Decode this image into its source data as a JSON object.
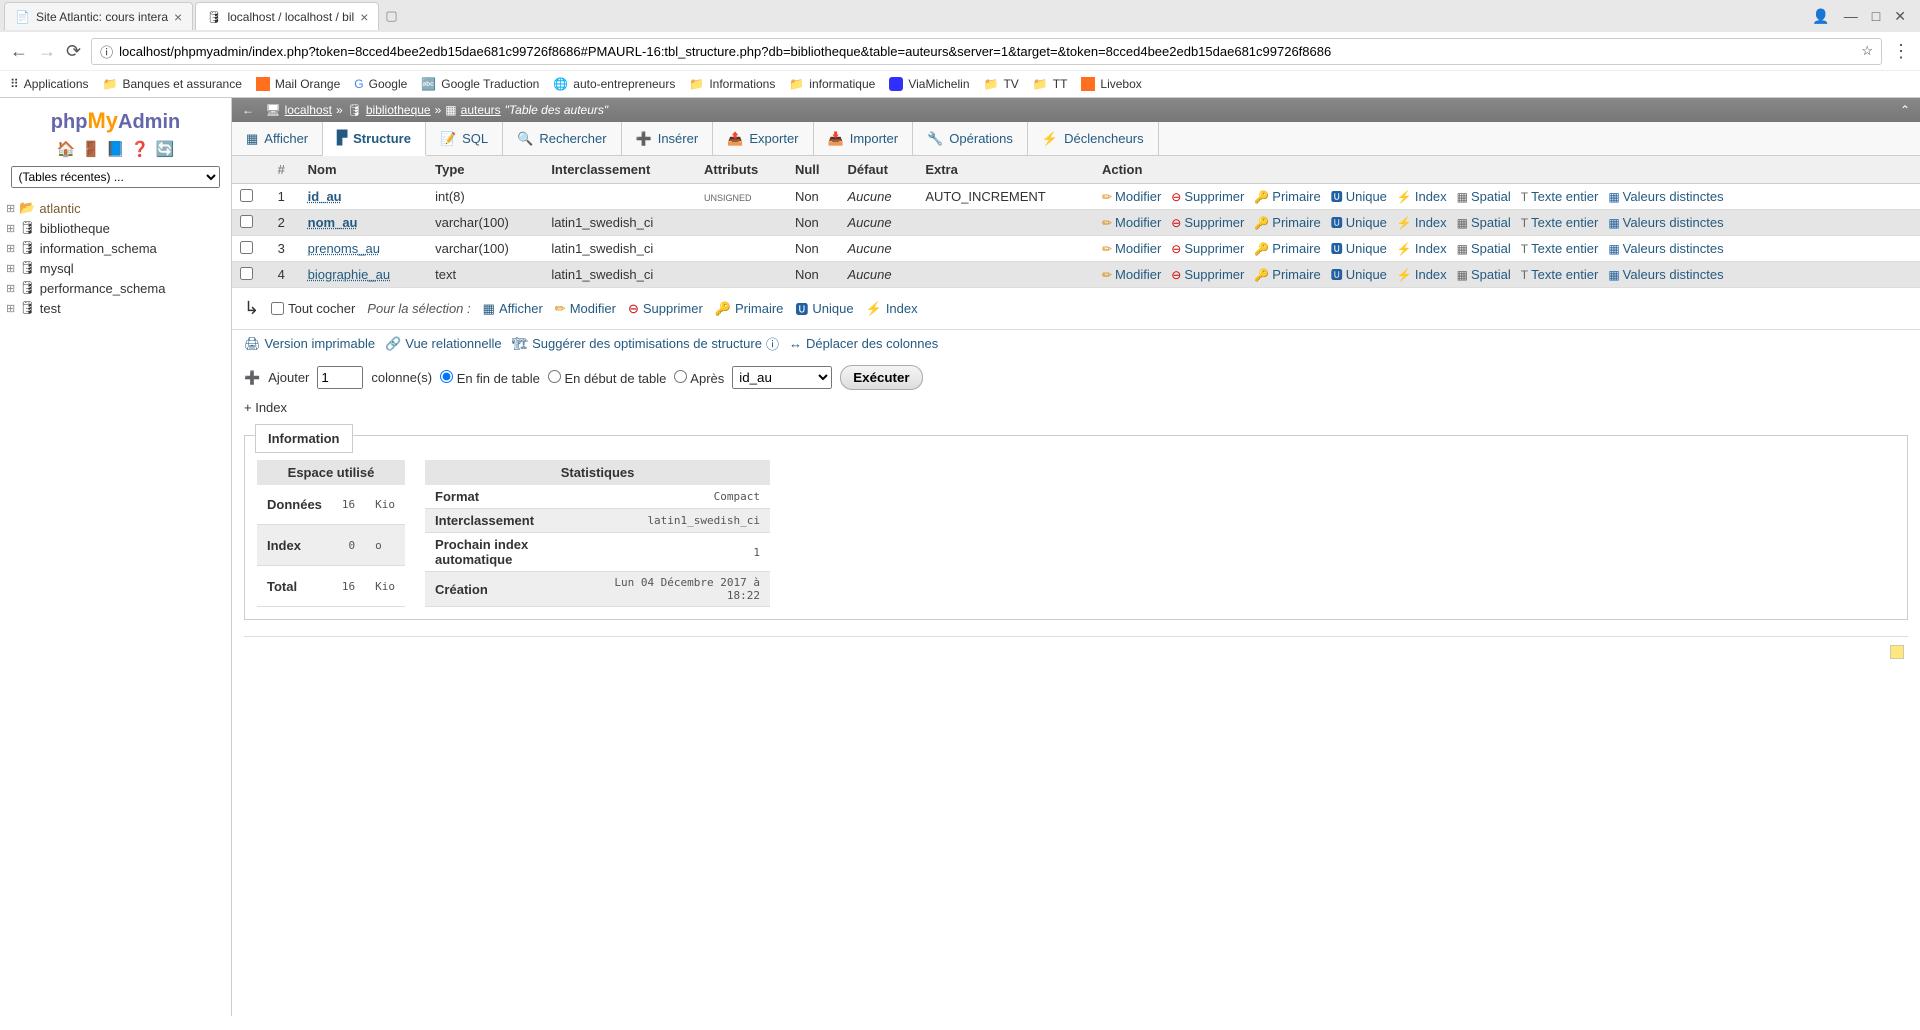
{
  "browser": {
    "tabs": [
      {
        "title": "Site Atlantic: cours intera"
      },
      {
        "title": "localhost / localhost / bil"
      }
    ],
    "url": "localhost/phpmyadmin/index.php?token=8cced4bee2edb15dae681c99726f8686#PMAURL-16:tbl_structure.php?db=bibliotheque&table=auteurs&server=1&target=&token=8cced4bee2edb15dae681c99726f8686",
    "bookmarks": [
      "Applications",
      "Banques et assurance",
      "Mail Orange",
      "Google",
      "Google Traduction",
      "auto-entrepreneurs",
      "Informations",
      "informatique",
      "ViaMichelin",
      "TV",
      "TT",
      "Livebox"
    ]
  },
  "breadcrumb": {
    "server": "localhost",
    "db": "bibliotheque",
    "table": "auteurs",
    "comment": "\"Table des auteurs\""
  },
  "topTabs": {
    "afficher": "Afficher",
    "structure": "Structure",
    "sql": "SQL",
    "rechercher": "Rechercher",
    "inserer": "Insérer",
    "exporter": "Exporter",
    "importer": "Importer",
    "operations": "Opérations",
    "declencheurs": "Déclencheurs"
  },
  "sidebar": {
    "recent": "(Tables récentes) ...",
    "items": [
      "atlantic",
      "bibliotheque",
      "information_schema",
      "mysql",
      "performance_schema",
      "test"
    ]
  },
  "struct": {
    "headers": {
      "num": "#",
      "nom": "Nom",
      "type": "Type",
      "inter": "Interclassement",
      "attr": "Attributs",
      "null": "Null",
      "defaut": "Défaut",
      "extra": "Extra",
      "action": "Action"
    },
    "rows": [
      {
        "n": "1",
        "name": "id_au",
        "bold": true,
        "type": "int(8)",
        "collation": "",
        "attr": "UNSIGNED",
        "null": "Non",
        "def": "Aucune",
        "extra": "AUTO_INCREMENT"
      },
      {
        "n": "2",
        "name": "nom_au",
        "bold": true,
        "type": "varchar(100)",
        "collation": "latin1_swedish_ci",
        "attr": "",
        "null": "Non",
        "def": "Aucune",
        "extra": ""
      },
      {
        "n": "3",
        "name": "prenoms_au",
        "bold": false,
        "type": "varchar(100)",
        "collation": "latin1_swedish_ci",
        "attr": "",
        "null": "Non",
        "def": "Aucune",
        "extra": ""
      },
      {
        "n": "4",
        "name": "biographie_au",
        "bold": false,
        "type": "text",
        "collation": "latin1_swedish_ci",
        "attr": "",
        "null": "Non",
        "def": "Aucune",
        "extra": ""
      }
    ],
    "actions": {
      "modifier": "Modifier",
      "supprimer": "Supprimer",
      "primaire": "Primaire",
      "unique": "Unique",
      "index": "Index",
      "spatial": "Spatial",
      "texte": "Texte entier",
      "distinct": "Valeurs distinctes"
    }
  },
  "bulk": {
    "checkAll": "Tout cocher",
    "forSelection": "Pour la sélection :",
    "afficher": "Afficher",
    "modifier": "Modifier",
    "supprimer": "Supprimer",
    "primaire": "Primaire",
    "unique": "Unique",
    "index": "Index"
  },
  "tools": {
    "print": "Version imprimable",
    "relation": "Vue relationnelle",
    "suggest": "Suggérer des optimisations de structure",
    "move": "Déplacer des colonnes"
  },
  "add": {
    "label": "Ajouter",
    "value": "1",
    "cols": "colonne(s)",
    "end": "En fin de table",
    "start": "En début de table",
    "after": "Après",
    "afterCol": "id_au",
    "exec": "Exécuter"
  },
  "plusIndex": "+ Index",
  "info": {
    "title": "Information",
    "space": {
      "title": "Espace utilisé",
      "rows": [
        [
          "Données",
          "16",
          "Kio"
        ],
        [
          "Index",
          "0",
          "o"
        ],
        [
          "Total",
          "16",
          "Kio"
        ]
      ]
    },
    "stats": {
      "title": "Statistiques",
      "rows": [
        [
          "Format",
          "Compact"
        ],
        [
          "Interclassement",
          "latin1_swedish_ci"
        ],
        [
          "Prochain index automatique",
          "1"
        ],
        [
          "Création",
          "Lun 04 Décembre 2017 à 18:22"
        ]
      ]
    }
  }
}
